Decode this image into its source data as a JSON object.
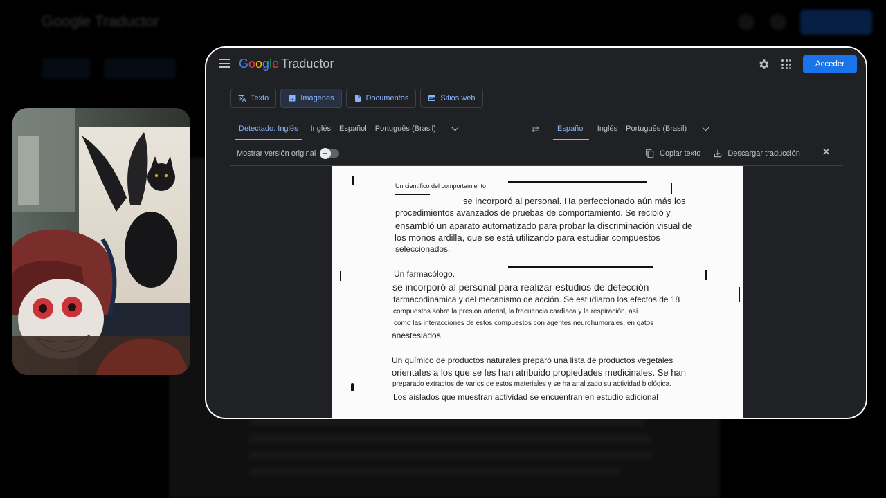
{
  "background": {
    "logo": "Google Traductor"
  },
  "window": {
    "title_logo": {
      "google_letters": [
        "G",
        "o",
        "o",
        "g",
        "l",
        "e"
      ],
      "product": "Traductor"
    },
    "signin_label": "Acceder",
    "mode_tabs": [
      {
        "label": "Texto",
        "icon": "translate-icon",
        "active": false
      },
      {
        "label": "Imágenes",
        "icon": "image-icon",
        "active": true
      },
      {
        "label": "Documentos",
        "icon": "document-icon",
        "active": false
      },
      {
        "label": "Sitios web",
        "icon": "web-icon",
        "active": false
      }
    ],
    "source_langs": [
      "Detectado: Inglés",
      "Inglés",
      "Español",
      "Português (Brasil)"
    ],
    "target_langs": [
      "Español",
      "Inglés",
      "Português (Brasil)"
    ],
    "show_original_label": "Mostrar versión original",
    "copy_label": "Copiar texto",
    "download_label": "Descargar traducción"
  },
  "document": {
    "lines": [
      "Un científico del comportamiento",
      "se incorporó al personal. Ha perfeccionado aún más los",
      "procedimientos avanzados de pruebas de comportamiento. Se recibió y",
      "ensambló un aparato automatizado para probar la discriminación visual de",
      "los monos ardilla, que se está utilizando para estudiar compuestos",
      "seleccionados.",
      "Un farmacólogo.",
      "se incorporó al personal para realizar estudios de detección",
      "farmacodinámica y del mecanismo de acción. Se estudiaron los efectos de 18",
      "compuestos sobre la presión arterial, la frecuencia cardíaca y la respiración, así",
      "como las interacciones de estos compuestos con agentes neurohumorales, en gatos",
      "anestesiados.",
      "Un químico de productos naturales preparó una lista de productos vegetales",
      "orientales a los que se les han atribuido propiedades medicinales. Se han",
      "preparado extractos de varios de estos materiales y se ha analizado su actividad biológica.",
      "Los aislados que muestran actividad se encuentran en estudio adicional"
    ]
  },
  "colors": {
    "accent": "#8ab4f8",
    "button": "#1a73e8",
    "window_bg": "#202124"
  }
}
